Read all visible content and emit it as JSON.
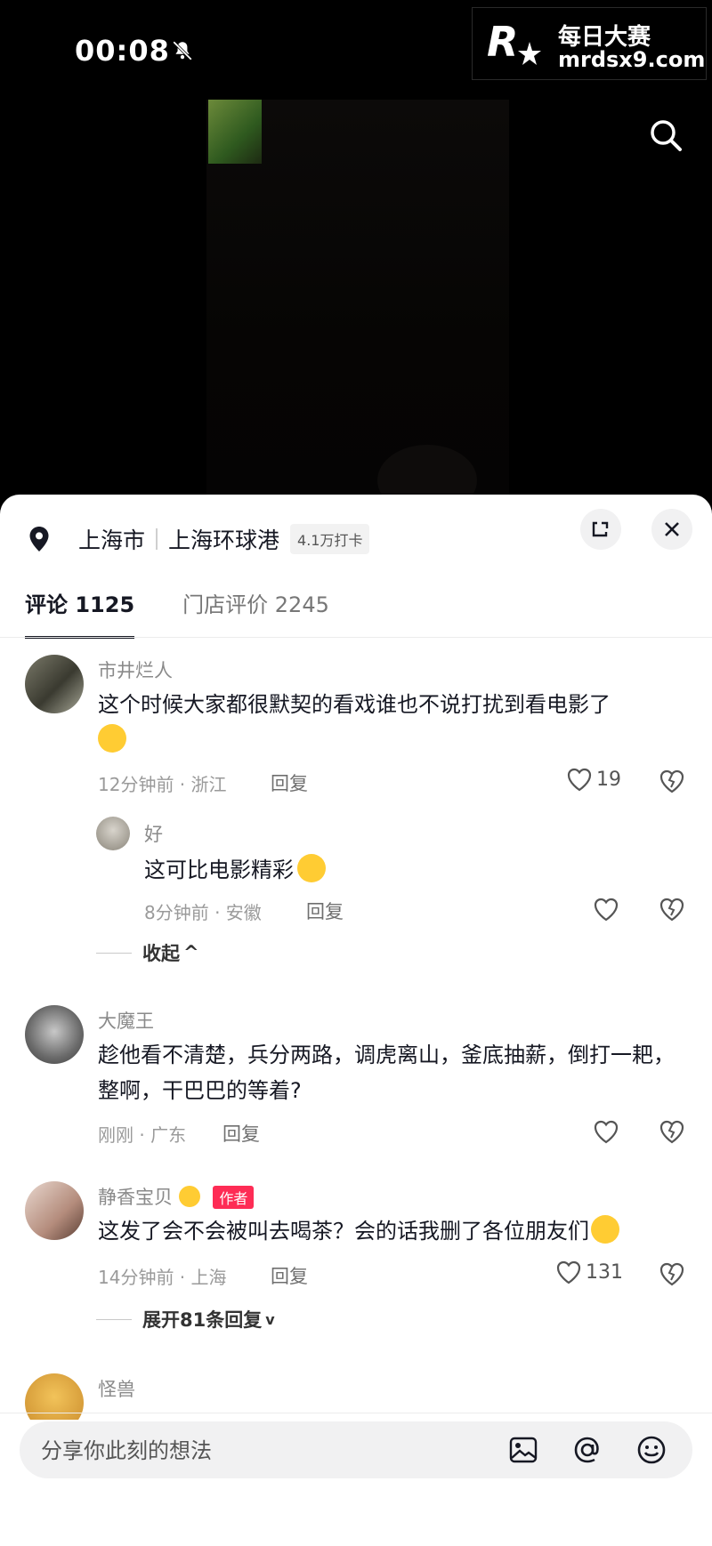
{
  "status": {
    "time": "00:08"
  },
  "watermark": {
    "title": "每日大赛",
    "url": "mrdsx9.com",
    "logo_text": "R"
  },
  "location": {
    "city": "上海市",
    "place": "上海环球港",
    "checkins": "4.1万打卡"
  },
  "tabs": [
    {
      "label": "评论 1125",
      "active": true
    },
    {
      "label": "门店评价 2245",
      "active": false
    }
  ],
  "comments": [
    {
      "name": "市井烂人",
      "text": "这个时候大家都很默契的看戏谁也不说打扰到看电影了",
      "meta": "12分钟前 · 浙江",
      "reply_label": "回复",
      "likes": "19"
    },
    {
      "name": "好",
      "text": "这可比电影精彩",
      "meta": "8分钟前 · 安徽",
      "reply_label": "回复",
      "likes": ""
    },
    {
      "name": "大魔王",
      "text": "趁他看不清楚，兵分两路，调虎离山，釜底抽薪，倒打一耙，整啊，干巴巴的等着?",
      "meta": "刚刚 · 广东",
      "reply_label": "回复",
      "likes": ""
    },
    {
      "name": "静香宝贝",
      "badge": "作者",
      "text": "这发了会不会被叫去喝茶？会的话我删了各位朋友们",
      "meta": "14分钟前 · 上海",
      "reply_label": "回复",
      "likes": "131"
    },
    {
      "name": "怪兽"
    }
  ],
  "collapse_label": "收起",
  "expand_label": "展开81条回复",
  "input": {
    "placeholder": "分享你此刻的想法"
  },
  "colors": {
    "accent": "#fe2c55",
    "text": "#161823",
    "muted": "#8a8a8a"
  }
}
